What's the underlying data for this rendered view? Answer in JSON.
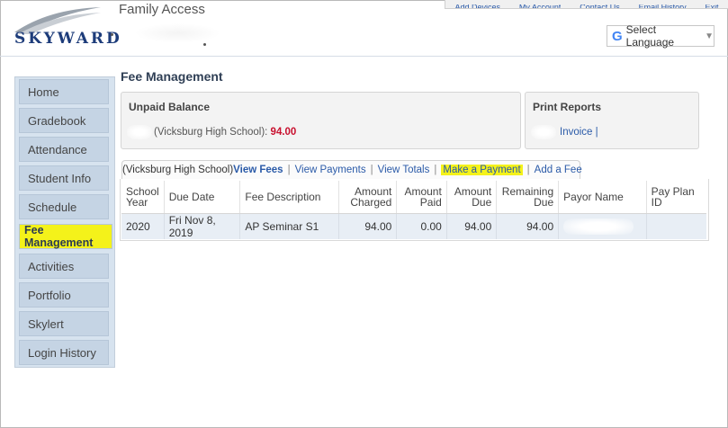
{
  "header": {
    "logo_text": "SKYWARD",
    "app_title": "Family Access",
    "top_nav": [
      "Add Devices",
      "My Account",
      "Contact Us",
      "Email History",
      "Exit"
    ],
    "language_button": "Select Language",
    "language_dropdown_glyph": "▼"
  },
  "sidebar": {
    "items": [
      {
        "label": "Home"
      },
      {
        "label": "Gradebook"
      },
      {
        "label": "Attendance"
      },
      {
        "label": "Student Info"
      },
      {
        "label": "Schedule"
      },
      {
        "label": "Fee Management"
      },
      {
        "label": "Activities"
      },
      {
        "label": "Portfolio"
      },
      {
        "label": "Skylert"
      },
      {
        "label": "Login History"
      }
    ],
    "active_index": 5
  },
  "main": {
    "title": "Fee Management",
    "unpaid_balance": {
      "title": "Unpaid Balance",
      "school": "(Vicksburg High School):",
      "amount": "94.00"
    },
    "print_reports": {
      "title": "Print Reports",
      "link": "Invoice |"
    },
    "tabs": {
      "school": "(Vicksburg High School)",
      "items": [
        "View Fees",
        "View Payments",
        "View Totals",
        "Make a Payment",
        "Add a Fee"
      ],
      "active": "View Fees",
      "highlighted": "Make a Payment"
    },
    "table": {
      "headers": [
        "School Year",
        "Due Date",
        "Fee Description",
        "Amount Charged",
        "Amount Paid",
        "Amount Due",
        "Remaining Due",
        "Payor Name",
        "Pay Plan ID"
      ],
      "rows": [
        [
          "2020",
          "Fri Nov 8, 2019",
          "AP Seminar S1",
          "94.00",
          "0.00",
          "94.00",
          "94.00",
          "",
          ""
        ]
      ]
    }
  },
  "colors": {
    "highlight": "#f4f21a",
    "link": "#2a5aa8",
    "balance": "#c8102e",
    "sidebar_bg": "#d7e3ef"
  }
}
